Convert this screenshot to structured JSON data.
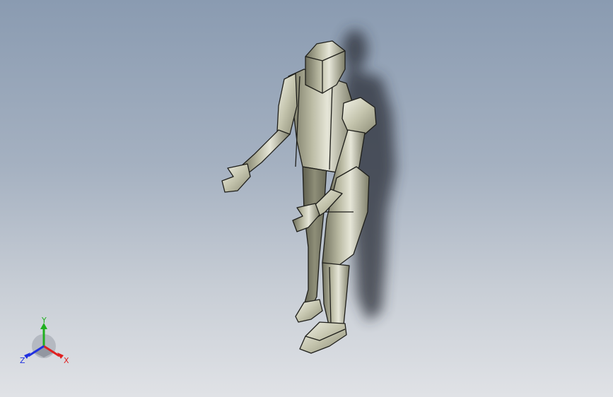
{
  "viewport": {
    "background_top": "#8a9bb1",
    "background_bottom": "#e0e2e6",
    "model_color": "#9a9a82",
    "edge_color": "#1e1e1a"
  },
  "triad": {
    "x_label": "X",
    "y_label": "Y",
    "z_label": "Z",
    "x_color": "#e02020",
    "y_color": "#20b020",
    "z_color": "#2030e0"
  }
}
